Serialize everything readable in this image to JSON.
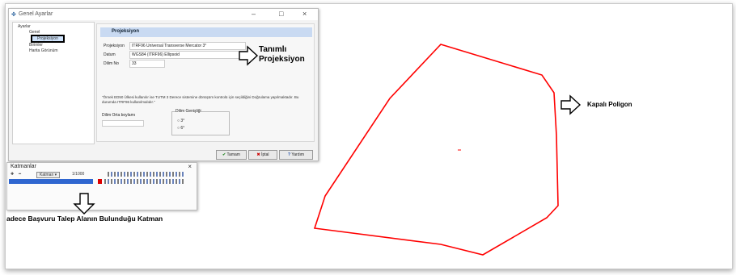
{
  "settings_window": {
    "title": "Genel Ayarlar",
    "tree": {
      "root": "Ayarlar",
      "items": [
        "Genel",
        "Projeksiyon",
        "Birimler",
        "Harita Görünüm"
      ],
      "selected_index": 1
    },
    "panel_title": "Projeksiyon",
    "fields": [
      {
        "label": "Projeksiyon",
        "value": "ITRF96 Universal Transverse Mercator 3°"
      },
      {
        "label": "Datum",
        "value": "WGS84 (ITRF96) Ellipsoid"
      },
      {
        "label": "Dilim No",
        "value": "33"
      }
    ],
    "note": "\"Örnek ED50 Ülkesi kullanılır ise TUTM 3 Derece sistemine dönüşüm kontrolü için seçildiğini Doğrulama yapılmaktadır. Bu durumda ITRF96 kullanılmalıdır.\"",
    "groups": [
      {
        "label": "Dilim Orta boylamı"
      },
      {
        "label": "Dilim Genişliği",
        "options": [
          "3°",
          "6°"
        ]
      }
    ],
    "buttons": {
      "ok": "Tamam",
      "cancel": "İptal",
      "help": "Yardım"
    }
  },
  "layers_window": {
    "title": "Katmanlar",
    "toolbar": {
      "dropdown": "Katman",
      "zoom": "1/1000"
    },
    "close_symbol": "×"
  },
  "annotations": {
    "projection_label_line1": "Tanımlı",
    "projection_label_line2": "Projeksiyon",
    "polygon_label": "Kapalı Poligon",
    "layer_label": "adece Başvuru Talep Alanın Bulunduğu Katman"
  },
  "colors": {
    "polygon_stroke": "#ff0000",
    "selection": "#2f66d0",
    "panel_header": "#c9daf2"
  }
}
